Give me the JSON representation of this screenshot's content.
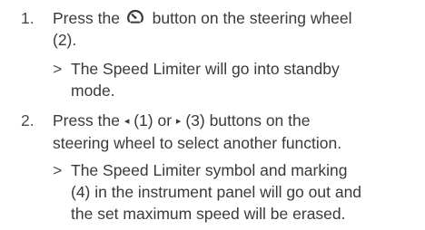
{
  "steps": [
    {
      "number": "1.",
      "lines": {
        "l1_before": "Press the",
        "icon": "speed-limiter-icon",
        "l1_after": "button on the steering wheel",
        "l2": "(2)."
      },
      "result": {
        "marker": ">",
        "lines": [
          "The Speed Limiter will go into standby",
          "mode."
        ]
      }
    },
    {
      "number": "2.",
      "lines": {
        "l1_a": "Press the",
        "left_arrow": "◂",
        "l1_b": "(1) or",
        "right_arrow": "▸",
        "l1_c": "(3) buttons on the",
        "l2": "steering wheel to select another function."
      },
      "result": {
        "marker": ">",
        "lines": [
          "The Speed Limiter symbol and marking",
          "(4) in the instrument panel will go out and",
          "the set maximum speed will be erased."
        ]
      }
    }
  ]
}
